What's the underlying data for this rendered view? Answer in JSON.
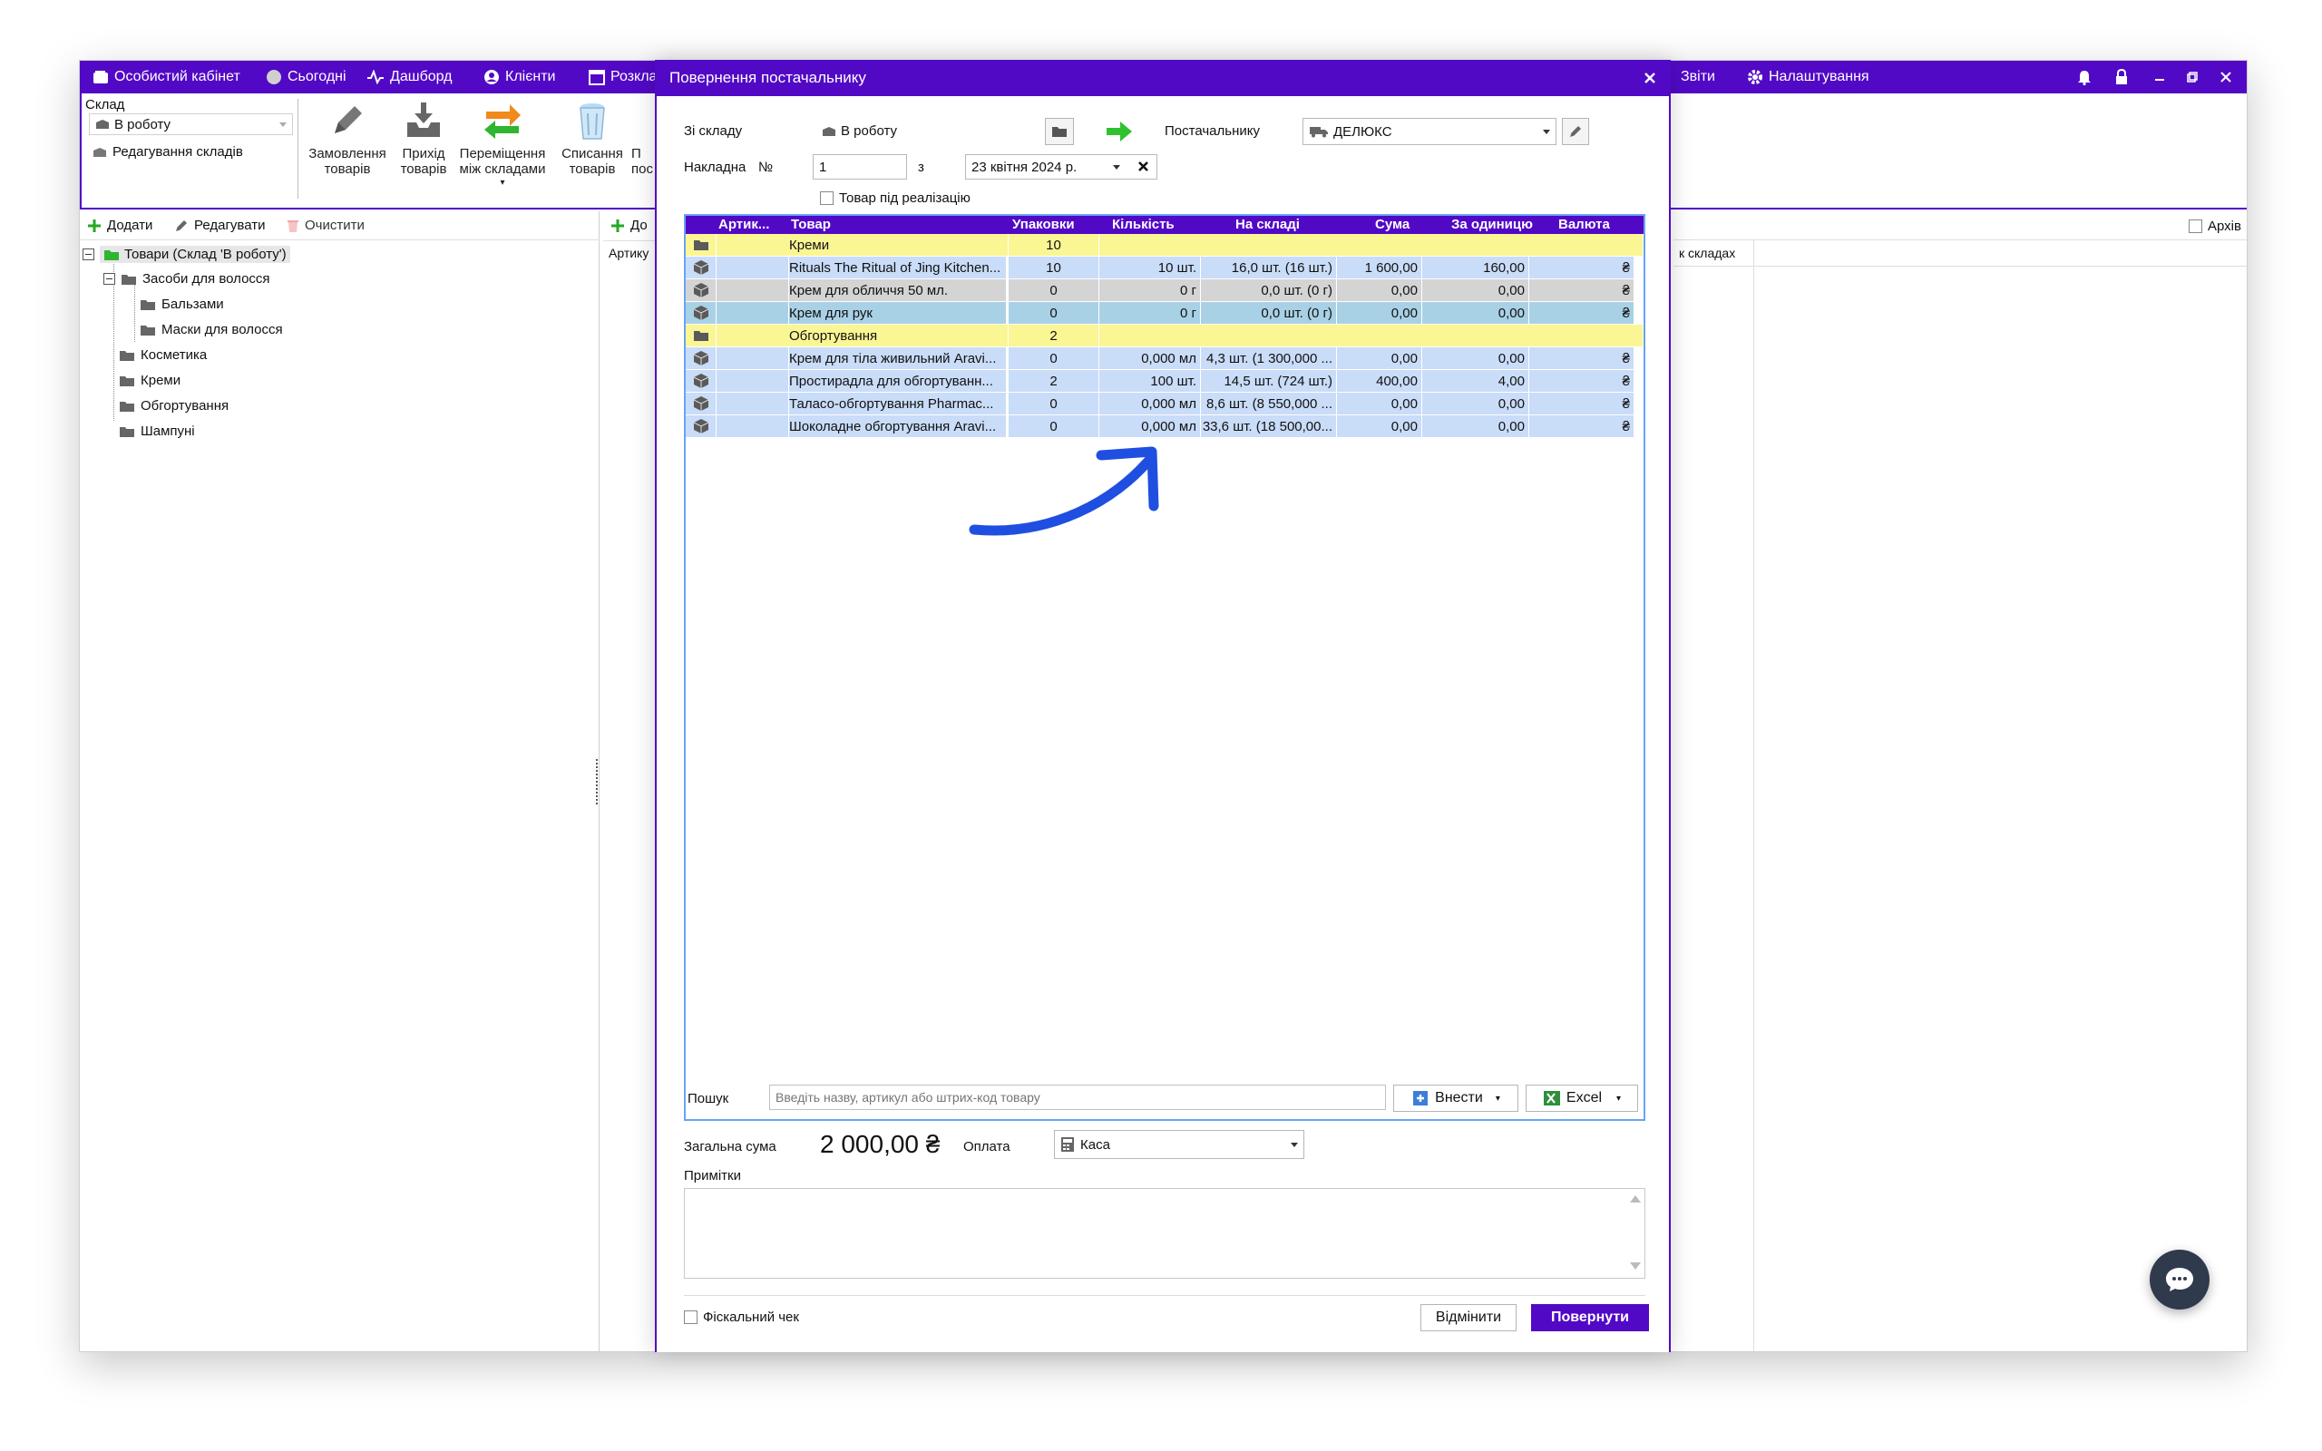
{
  "topbar": {
    "items": [
      "Особистий кабінет",
      "Сьогодні",
      "Дашборд",
      "Клієнти",
      "Розкла",
      "Звіти",
      "Налаштування"
    ]
  },
  "ribbon": {
    "warehouse_label": "Склад",
    "warehouse_value": "В роботу",
    "edit_warehouses": "Редагування складів",
    "buttons": [
      {
        "label1": "Замовлення",
        "label2": "товарів",
        "icon": "pencil-icon"
      },
      {
        "label1": "Прихід",
        "label2": "товарів",
        "icon": "inbox-download-icon"
      },
      {
        "label1": "Переміщення",
        "label2": "між складами",
        "icon": "transfer-arrows-icon"
      },
      {
        "label1": "Списання",
        "label2": "товарів",
        "icon": "trash-icon"
      },
      {
        "label1": "П",
        "label2": "пос",
        "icon": "partial-icon"
      }
    ]
  },
  "left_panel": {
    "add": "Додати",
    "edit": "Редагувати",
    "clear": "Очистити",
    "tree": [
      {
        "label": "Товари (Склад 'В роботу')",
        "level": 0
      },
      {
        "label": "Засоби для волосся",
        "level": 1
      },
      {
        "label": "Бальзами",
        "level": 2
      },
      {
        "label": "Маски для волосся",
        "level": 2
      },
      {
        "label": "Косметика",
        "level": 1
      },
      {
        "label": "Креми",
        "level": 1
      },
      {
        "label": "Обгортування",
        "level": 1
      },
      {
        "label": "Шампуні",
        "level": 1
      }
    ]
  },
  "middle_panel": {
    "add": "До",
    "col": "Артику"
  },
  "right_panel": {
    "archive": "Архів",
    "col": "к складах"
  },
  "dialog": {
    "title": "Повернення постачальнику",
    "from_warehouse_label": "Зі складу",
    "from_warehouse_value": "В роботу",
    "supplier_label": "Постачальнику",
    "supplier_value": "ДЕЛЮКС",
    "invoice_label": "Накладна",
    "invoice_no_label": "№",
    "invoice_no": "1",
    "date_from_label": "з",
    "date": "23 квітня 2024 р.",
    "consignment_label": "Товар під реалізацію",
    "columns": [
      "Артик...",
      "Товар",
      "Упаковки",
      "Кількість",
      "На складі",
      "Сума",
      "За одиницю",
      "Валюта"
    ],
    "rows": [
      {
        "type": "cat",
        "name": "Креми",
        "packs": "10"
      },
      {
        "type": "item",
        "name": "Rituals The Ritual of Jing Kitchen...",
        "packs": "10",
        "qty": "10 шт.",
        "stock": "16,0 шт. (16 шт.)",
        "sum": "1 600,00",
        "unit": "160,00",
        "cur": "₴",
        "style": "blue"
      },
      {
        "type": "item",
        "name": "Крем для обличчя 50 мл.",
        "packs": "0",
        "qty": "0 г",
        "stock": "0,0 шт. (0 г)",
        "sum": "0,00",
        "unit": "0,00",
        "cur": "₴",
        "style": "gray"
      },
      {
        "type": "item",
        "name": "Крем для рук",
        "packs": "0",
        "qty": "0 г",
        "stock": "0,0 шт. (0 г)",
        "sum": "0,00",
        "unit": "0,00",
        "cur": "₴",
        "style": "sel"
      },
      {
        "type": "cat",
        "name": "Обгортування",
        "packs": "2"
      },
      {
        "type": "item",
        "name": "Крем для тіла живильний Aravi...",
        "packs": "0",
        "qty": "0,000 мл",
        "stock": "4,3 шт. (1 300,000 ...",
        "sum": "0,00",
        "unit": "0,00",
        "cur": "₴",
        "style": "blue"
      },
      {
        "type": "item",
        "name": "Простирадла для обгортуванн...",
        "packs": "2",
        "qty": "100 шт.",
        "stock": "14,5 шт. (724 шт.)",
        "sum": "400,00",
        "unit": "4,00",
        "cur": "₴",
        "style": "blue"
      },
      {
        "type": "item",
        "name": "Таласо-обгортування Pharmac...",
        "packs": "0",
        "qty": "0,000 мл",
        "stock": "8,6 шт. (8 550,000 ...",
        "sum": "0,00",
        "unit": "0,00",
        "cur": "₴",
        "style": "blue"
      },
      {
        "type": "item",
        "name": "Шоколадне обгортування Aravi...",
        "packs": "0",
        "qty": "0,000 мл",
        "stock": "33,6 шт. (18 500,00...",
        "sum": "0,00",
        "unit": "0,00",
        "cur": "₴",
        "style": "blue"
      }
    ],
    "search_label": "Пошук",
    "search_placeholder": "Введіть назву, артикул або штрих-код товару",
    "import_label": "Внести",
    "excel_label": "Excel",
    "total_label": "Загальна сума",
    "total_value": "2 000,00 ₴",
    "payment_label": "Оплата",
    "payment_value": "Каса",
    "notes_label": "Примітки",
    "fiscal_label": "Фіскальний чек",
    "cancel_label": "Відмінити",
    "return_label": "Повернути"
  },
  "colors": {
    "accent": "#5209c6",
    "category": "#fbf694",
    "row_blue": "#c9dcf8",
    "arrow": "#1f4fe0"
  }
}
